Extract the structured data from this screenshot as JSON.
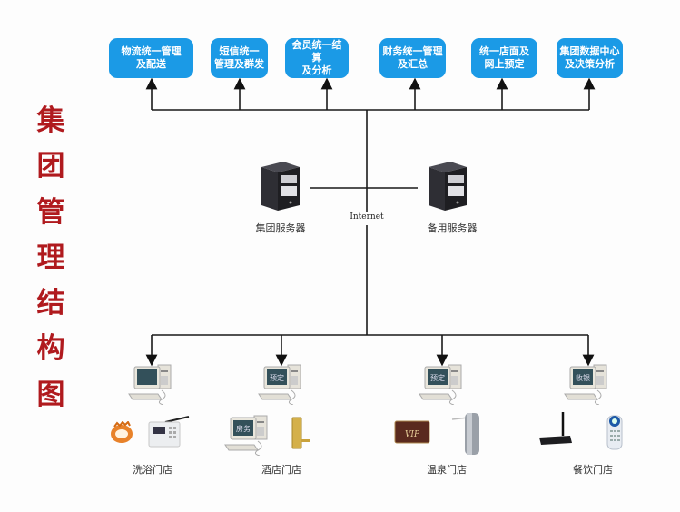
{
  "title": "集团管理结构图",
  "title_color": "#b01a1e",
  "box_color": "#1b9ae6",
  "function_boxes": [
    {
      "id": "logistics",
      "label": "物流统一管理\n及配送"
    },
    {
      "id": "sms",
      "label": "短信统一\n管理及群发"
    },
    {
      "id": "member",
      "label": "会员统一结算\n及分析"
    },
    {
      "id": "finance",
      "label": "财务统一管理\n及汇总"
    },
    {
      "id": "storefront",
      "label": "统一店面及\n网上预定"
    },
    {
      "id": "datacenter",
      "label": "集团数据中心\n及决策分析"
    }
  ],
  "servers": [
    {
      "id": "main",
      "label": "集团服务器",
      "icon": "server-icon"
    },
    {
      "id": "backup",
      "label": "备用服务器",
      "icon": "server-icon"
    }
  ],
  "network_label": "Internet",
  "stores": [
    {
      "id": "bath",
      "label": "洗浴门店",
      "terminal_screen": "",
      "devices": [
        "wristband-key-icon",
        "alarm-keypad-icon"
      ]
    },
    {
      "id": "hotel",
      "label": "酒店门店",
      "terminal_screen": "预定",
      "devices": [
        "front-desk-computer-icon",
        "door-lock-icon"
      ],
      "device_screen": "房务"
    },
    {
      "id": "spa",
      "label": "温泉门店",
      "terminal_screen": "预定",
      "devices": [
        "vip-card-icon",
        "turnstile-icon"
      ],
      "card_text": "VIP"
    },
    {
      "id": "dining",
      "label": "餐饮门店",
      "terminal_screen": "收银",
      "devices": [
        "wireless-router-icon",
        "handheld-terminal-icon"
      ]
    }
  ]
}
